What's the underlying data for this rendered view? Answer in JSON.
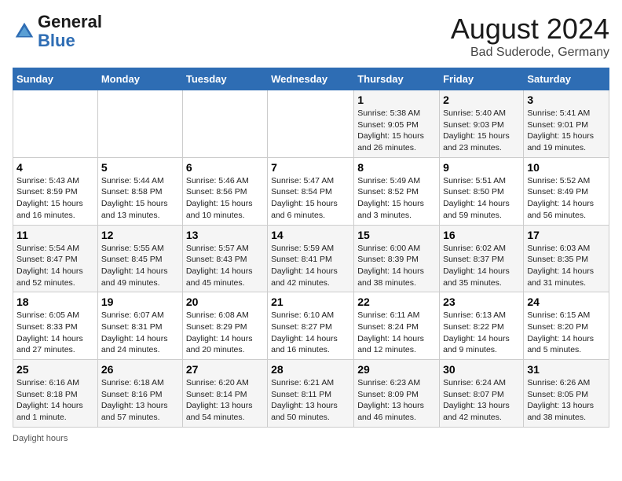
{
  "header": {
    "logo_line1": "General",
    "logo_line2": "Blue",
    "month_title": "August 2024",
    "location": "Bad Suderode, Germany"
  },
  "footer": {
    "label": "Daylight hours"
  },
  "days_of_week": [
    "Sunday",
    "Monday",
    "Tuesday",
    "Wednesday",
    "Thursday",
    "Friday",
    "Saturday"
  ],
  "weeks": [
    [
      {
        "day": "",
        "info": ""
      },
      {
        "day": "",
        "info": ""
      },
      {
        "day": "",
        "info": ""
      },
      {
        "day": "",
        "info": ""
      },
      {
        "day": "1",
        "info": "Sunrise: 5:38 AM\nSunset: 9:05 PM\nDaylight: 15 hours\nand 26 minutes."
      },
      {
        "day": "2",
        "info": "Sunrise: 5:40 AM\nSunset: 9:03 PM\nDaylight: 15 hours\nand 23 minutes."
      },
      {
        "day": "3",
        "info": "Sunrise: 5:41 AM\nSunset: 9:01 PM\nDaylight: 15 hours\nand 19 minutes."
      }
    ],
    [
      {
        "day": "4",
        "info": "Sunrise: 5:43 AM\nSunset: 8:59 PM\nDaylight: 15 hours\nand 16 minutes."
      },
      {
        "day": "5",
        "info": "Sunrise: 5:44 AM\nSunset: 8:58 PM\nDaylight: 15 hours\nand 13 minutes."
      },
      {
        "day": "6",
        "info": "Sunrise: 5:46 AM\nSunset: 8:56 PM\nDaylight: 15 hours\nand 10 minutes."
      },
      {
        "day": "7",
        "info": "Sunrise: 5:47 AM\nSunset: 8:54 PM\nDaylight: 15 hours\nand 6 minutes."
      },
      {
        "day": "8",
        "info": "Sunrise: 5:49 AM\nSunset: 8:52 PM\nDaylight: 15 hours\nand 3 minutes."
      },
      {
        "day": "9",
        "info": "Sunrise: 5:51 AM\nSunset: 8:50 PM\nDaylight: 14 hours\nand 59 minutes."
      },
      {
        "day": "10",
        "info": "Sunrise: 5:52 AM\nSunset: 8:49 PM\nDaylight: 14 hours\nand 56 minutes."
      }
    ],
    [
      {
        "day": "11",
        "info": "Sunrise: 5:54 AM\nSunset: 8:47 PM\nDaylight: 14 hours\nand 52 minutes."
      },
      {
        "day": "12",
        "info": "Sunrise: 5:55 AM\nSunset: 8:45 PM\nDaylight: 14 hours\nand 49 minutes."
      },
      {
        "day": "13",
        "info": "Sunrise: 5:57 AM\nSunset: 8:43 PM\nDaylight: 14 hours\nand 45 minutes."
      },
      {
        "day": "14",
        "info": "Sunrise: 5:59 AM\nSunset: 8:41 PM\nDaylight: 14 hours\nand 42 minutes."
      },
      {
        "day": "15",
        "info": "Sunrise: 6:00 AM\nSunset: 8:39 PM\nDaylight: 14 hours\nand 38 minutes."
      },
      {
        "day": "16",
        "info": "Sunrise: 6:02 AM\nSunset: 8:37 PM\nDaylight: 14 hours\nand 35 minutes."
      },
      {
        "day": "17",
        "info": "Sunrise: 6:03 AM\nSunset: 8:35 PM\nDaylight: 14 hours\nand 31 minutes."
      }
    ],
    [
      {
        "day": "18",
        "info": "Sunrise: 6:05 AM\nSunset: 8:33 PM\nDaylight: 14 hours\nand 27 minutes."
      },
      {
        "day": "19",
        "info": "Sunrise: 6:07 AM\nSunset: 8:31 PM\nDaylight: 14 hours\nand 24 minutes."
      },
      {
        "day": "20",
        "info": "Sunrise: 6:08 AM\nSunset: 8:29 PM\nDaylight: 14 hours\nand 20 minutes."
      },
      {
        "day": "21",
        "info": "Sunrise: 6:10 AM\nSunset: 8:27 PM\nDaylight: 14 hours\nand 16 minutes."
      },
      {
        "day": "22",
        "info": "Sunrise: 6:11 AM\nSunset: 8:24 PM\nDaylight: 14 hours\nand 12 minutes."
      },
      {
        "day": "23",
        "info": "Sunrise: 6:13 AM\nSunset: 8:22 PM\nDaylight: 14 hours\nand 9 minutes."
      },
      {
        "day": "24",
        "info": "Sunrise: 6:15 AM\nSunset: 8:20 PM\nDaylight: 14 hours\nand 5 minutes."
      }
    ],
    [
      {
        "day": "25",
        "info": "Sunrise: 6:16 AM\nSunset: 8:18 PM\nDaylight: 14 hours\nand 1 minute."
      },
      {
        "day": "26",
        "info": "Sunrise: 6:18 AM\nSunset: 8:16 PM\nDaylight: 13 hours\nand 57 minutes."
      },
      {
        "day": "27",
        "info": "Sunrise: 6:20 AM\nSunset: 8:14 PM\nDaylight: 13 hours\nand 54 minutes."
      },
      {
        "day": "28",
        "info": "Sunrise: 6:21 AM\nSunset: 8:11 PM\nDaylight: 13 hours\nand 50 minutes."
      },
      {
        "day": "29",
        "info": "Sunrise: 6:23 AM\nSunset: 8:09 PM\nDaylight: 13 hours\nand 46 minutes."
      },
      {
        "day": "30",
        "info": "Sunrise: 6:24 AM\nSunset: 8:07 PM\nDaylight: 13 hours\nand 42 minutes."
      },
      {
        "day": "31",
        "info": "Sunrise: 6:26 AM\nSunset: 8:05 PM\nDaylight: 13 hours\nand 38 minutes."
      }
    ]
  ]
}
